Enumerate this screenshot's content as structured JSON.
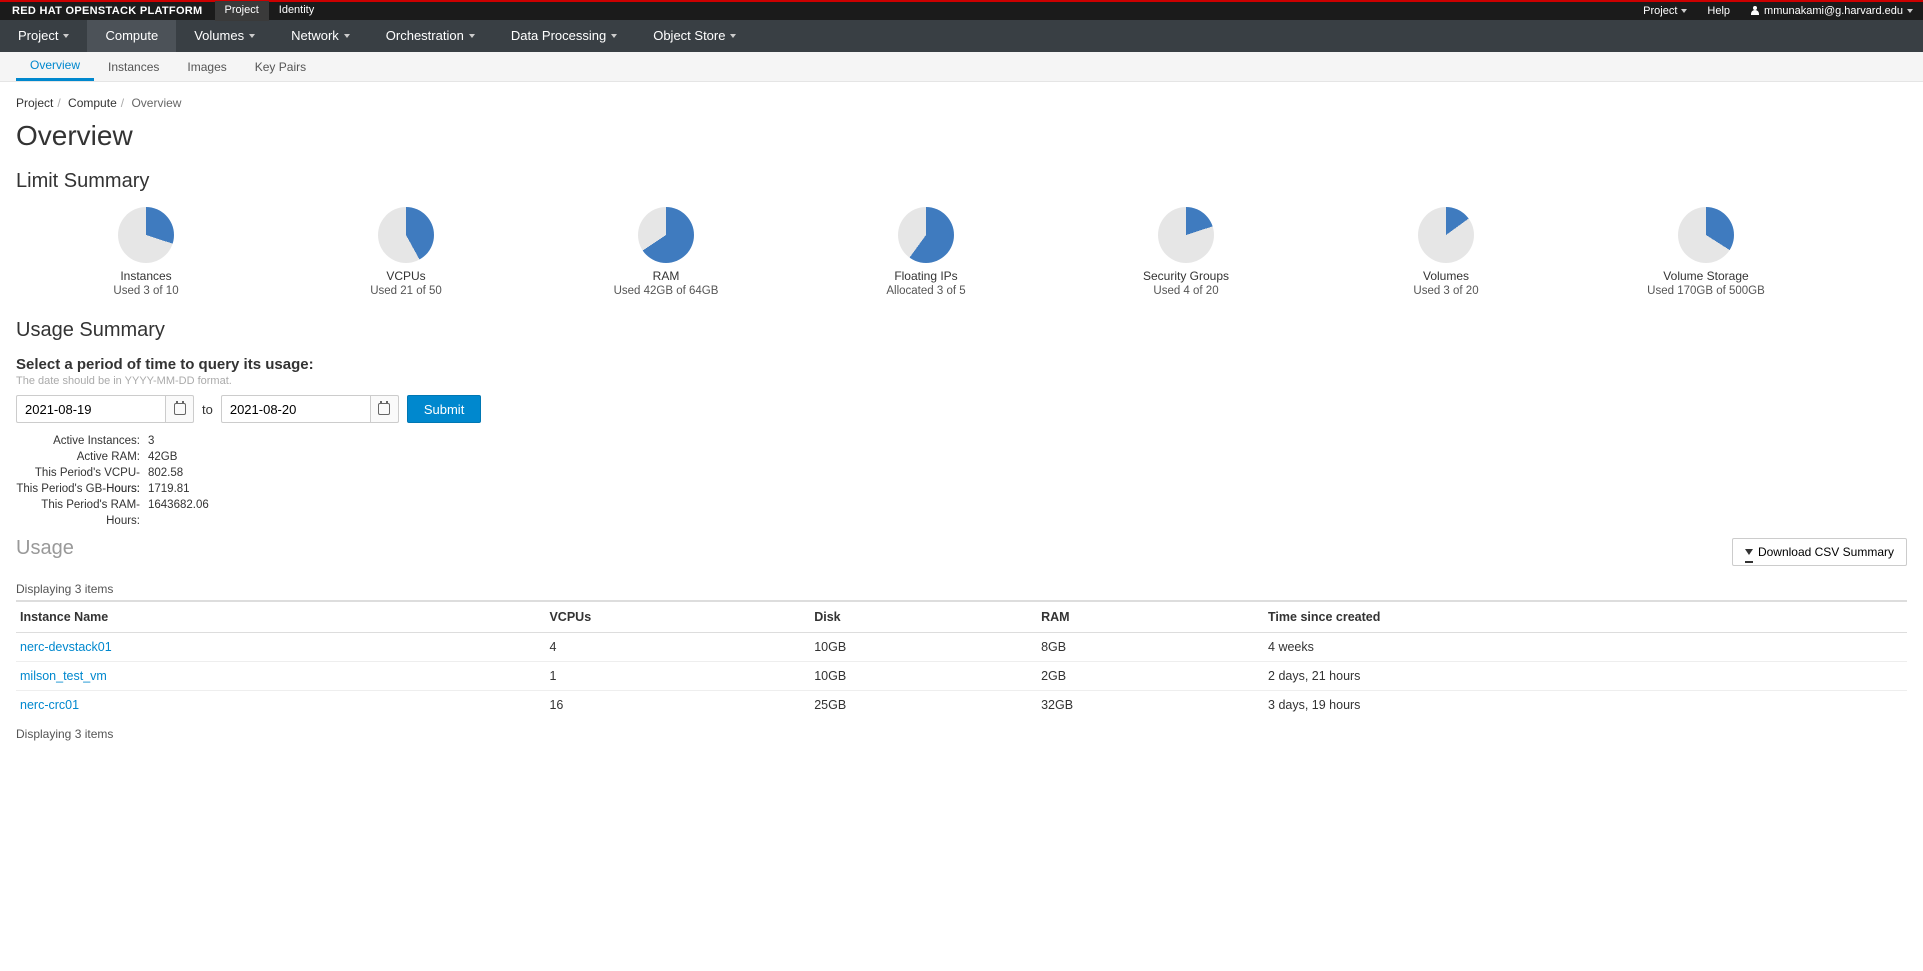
{
  "brand": "RED HAT OPENSTACK PLATFORM",
  "topTabs": [
    "Project",
    "Identity"
  ],
  "topRight": {
    "project": "Project",
    "help": "Help",
    "user": "mmunakami@g.harvard.edu"
  },
  "nav": [
    "Project",
    "Compute",
    "Volumes",
    "Network",
    "Orchestration",
    "Data Processing",
    "Object Store"
  ],
  "subnav": [
    "Overview",
    "Instances",
    "Images",
    "Key Pairs"
  ],
  "breadcrumb": [
    "Project",
    "Compute",
    "Overview"
  ],
  "pageTitle": "Overview",
  "limitHeading": "Limit Summary",
  "limits": [
    {
      "title": "Instances",
      "sub": "Used 3 of 10",
      "used": 3,
      "total": 10
    },
    {
      "title": "VCPUs",
      "sub": "Used 21 of 50",
      "used": 21,
      "total": 50
    },
    {
      "title": "RAM",
      "sub": "Used 42GB of 64GB",
      "used": 42,
      "total": 64
    },
    {
      "title": "Floating IPs",
      "sub": "Allocated 3 of 5",
      "used": 3,
      "total": 5
    },
    {
      "title": "Security Groups",
      "sub": "Used 4 of 20",
      "used": 4,
      "total": 20
    },
    {
      "title": "Volumes",
      "sub": "Used 3 of 20",
      "used": 3,
      "total": 20
    },
    {
      "title": "Volume Storage",
      "sub": "Used 170GB of 500GB",
      "used": 170,
      "total": 500
    }
  ],
  "usageHeading": "Usage Summary",
  "dateHeading": "Select a period of time to query its usage:",
  "dateHint": "The date should be in YYYY-MM-DD format.",
  "dateFrom": "2021-08-19",
  "dateTo": "2021-08-20",
  "to": "to",
  "submit": "Submit",
  "stats": [
    {
      "lbl": "Active Instances:",
      "val": "3"
    },
    {
      "lbl": "Active RAM:",
      "val": "42GB"
    },
    {
      "lbl": "This Period's VCPU-Hours:",
      "val": "802.58"
    },
    {
      "lbl": "This Period's GB-Hours:",
      "val": "1719.81"
    },
    {
      "lbl": "This Period's RAM-Hours:",
      "val": "1643682.06"
    }
  ],
  "usageTitle": "Usage",
  "download": "Download CSV Summary",
  "displaying": "Displaying 3 items",
  "cols": [
    "Instance Name",
    "VCPUs",
    "Disk",
    "RAM",
    "Time since created"
  ],
  "rows": [
    {
      "name": "nerc-devstack01",
      "vcpus": "4",
      "disk": "10GB",
      "ram": "8GB",
      "time": "4 weeks"
    },
    {
      "name": "milson_test_vm",
      "vcpus": "1",
      "disk": "10GB",
      "ram": "2GB",
      "time": "2 days, 21 hours"
    },
    {
      "name": "nerc-crc01",
      "vcpus": "16",
      "disk": "25GB",
      "ram": "32GB",
      "time": "3 days, 19 hours"
    }
  ],
  "chart_data": {
    "type": "pie",
    "note": "each limit pie shows used fraction",
    "series": [
      {
        "name": "Instances",
        "used": 3,
        "total": 10
      },
      {
        "name": "VCPUs",
        "used": 21,
        "total": 50
      },
      {
        "name": "RAM",
        "used": 42,
        "total": 64
      },
      {
        "name": "Floating IPs",
        "used": 3,
        "total": 5
      },
      {
        "name": "Security Groups",
        "used": 4,
        "total": 20
      },
      {
        "name": "Volumes",
        "used": 3,
        "total": 20
      },
      {
        "name": "Volume Storage",
        "used": 170,
        "total": 500
      }
    ]
  },
  "colors": {
    "used": "#3f7bbf",
    "unused": "#e6e6e6",
    "accent": "#0088ce"
  }
}
